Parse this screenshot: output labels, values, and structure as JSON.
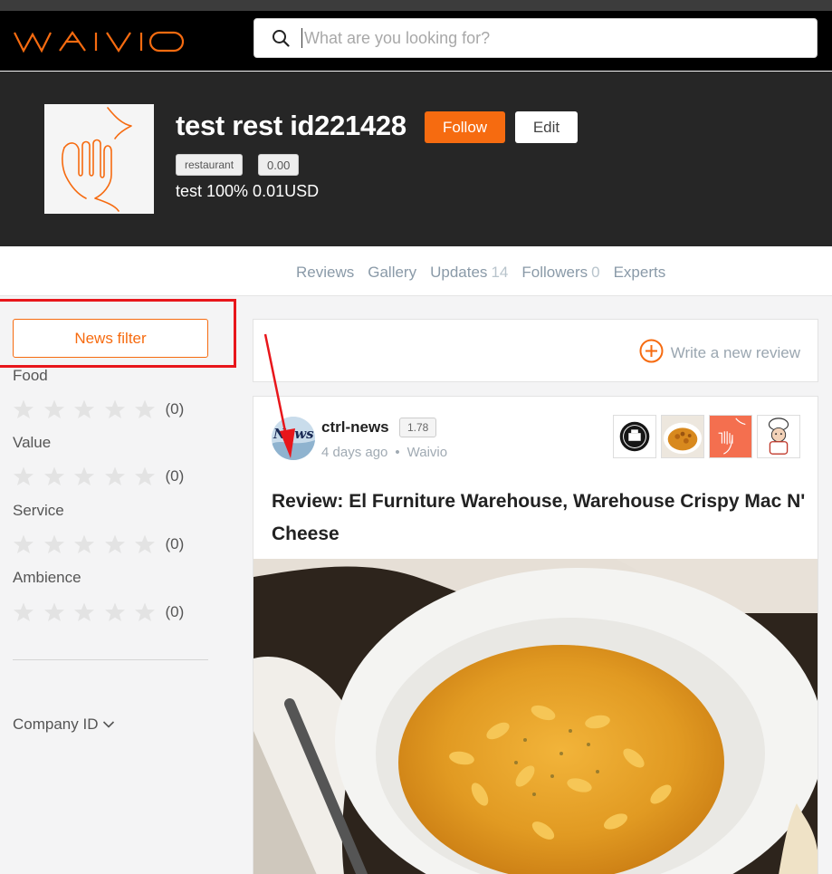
{
  "brand": {
    "logo_text": "WAIVIO",
    "accent": "#f66b10"
  },
  "search": {
    "placeholder": "What are you looking for?",
    "value": ""
  },
  "object": {
    "name": "test rest id221428",
    "follow_label": "Follow",
    "edit_label": "Edit",
    "type_tag": "restaurant",
    "rating_tag": "0.00",
    "description": "test 100% 0.01USD"
  },
  "nav": {
    "tabs": [
      {
        "label": "Reviews",
        "count": ""
      },
      {
        "label": "Gallery",
        "count": ""
      },
      {
        "label": "Updates",
        "count": "14"
      },
      {
        "label": "Followers",
        "count": "0"
      },
      {
        "label": "Experts",
        "count": ""
      }
    ]
  },
  "sidebar": {
    "news_filter_label": "News filter",
    "ratings": [
      {
        "label": "Food",
        "count": "(0)"
      },
      {
        "label": "Value",
        "count": "(0)"
      },
      {
        "label": "Service",
        "count": "(0)"
      },
      {
        "label": "Ambience",
        "count": "(0)"
      }
    ],
    "company_label": "Company ID"
  },
  "write_review": {
    "label": "Write a new review"
  },
  "post": {
    "author_avatar_text": "News",
    "author": "ctrl-news",
    "reputation": "1.78",
    "time": "4 days ago",
    "dot": "•",
    "app": "Waivio",
    "title": "Review: El Furniture Warehouse, Warehouse Crispy Mac N' Cheese",
    "image_icon": "mac-and-cheese-photo"
  },
  "annotation": {
    "highlight_color": "#e8161b"
  }
}
